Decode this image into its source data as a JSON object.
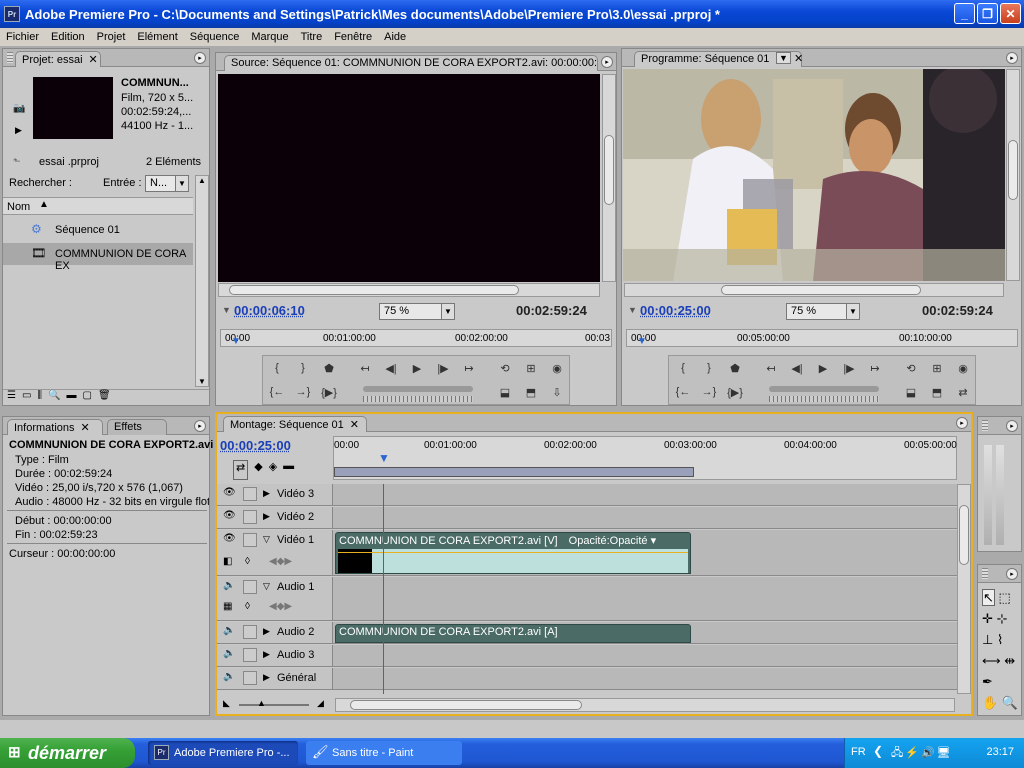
{
  "window": {
    "title": "Adobe Premiere Pro - C:\\Documents and Settings\\Patrick\\Mes documents\\Adobe\\Premiere Pro\\3.0\\essai .prproj *",
    "app_icon": "Pr"
  },
  "menu": [
    "Fichier",
    "Edition",
    "Projet",
    "Elément",
    "Séquence",
    "Marque",
    "Titre",
    "Fenêtre",
    "Aide"
  ],
  "project": {
    "tab": "Projet: essai",
    "clip_name": "COMMNUN...",
    "clip_line1": "Film, 720 x 5...",
    "clip_line2": "00:02:59:24,...",
    "clip_line3": "44100 Hz - 1...",
    "file": "essai .prproj",
    "count": "2 Eléments",
    "search_label": "Rechercher :",
    "entry_label": "Entrée :",
    "entry_value": "N...",
    "col_name": "Nom",
    "items": [
      {
        "label": "Séquence 01"
      },
      {
        "label": "COMMNUNION DE CORA EX"
      }
    ]
  },
  "source": {
    "tab": "Source: Séquence 01: COMMNUNION DE CORA EXPORT2.avi: 00:00:00:0",
    "timecode": "00:00:06:10",
    "zoom": "75 %",
    "duration": "00:02:59:24",
    "ruler": [
      "00:00",
      "00:01:00:00",
      "00:02:00:00",
      "00:03"
    ]
  },
  "program": {
    "tab": "Programme: Séquence 01",
    "timecode": "00:00:25:00",
    "zoom": "75 %",
    "duration": "00:02:59:24",
    "ruler": [
      "00:00",
      "00:05:00:00",
      "00:10:00:00"
    ]
  },
  "info": {
    "tab_info": "Informations",
    "tab_effects": "Effets",
    "name": "COMMNUNION DE CORA EXPORT2.avi",
    "type": "Type : Film",
    "duration": "Durée : 00:02:59:24",
    "video": "Vidéo : 25,00 i/s,720 x 576 (1,067)",
    "audio": "Audio : 48000 Hz - 32 bits en virgule flot",
    "start": "Début : 00:00:00:00",
    "end": "Fin : 00:02:59:23",
    "cursor": "Curseur : 00:00:00:00"
  },
  "timeline": {
    "tab": "Montage: Séquence 01",
    "timecode": "00:00:25:00",
    "ruler": [
      "00:00",
      "00:01:00:00",
      "00:02:00:00",
      "00:03:00:00",
      "00:04:00:00",
      "00:05:00:00"
    ],
    "tracks": [
      "Vidéo 3",
      "Vidéo 2",
      "Vidéo 1",
      "Audio 1",
      "Audio 2",
      "Audio 3",
      "Général"
    ],
    "video_clip": "COMMNUNION DE CORA EXPORT2.avi [V]",
    "opacity": "Opacité:Opacité",
    "audio_clip": "COMMNUNION DE CORA EXPORT2.avi [A]"
  },
  "taskbar": {
    "start": "démarrer",
    "items": [
      "Adobe Premiere Pro -...",
      "Sans titre - Paint"
    ],
    "lang": "FR",
    "clock": "23:17"
  },
  "colors": {
    "accent": "#1a3fb8",
    "clip": "#4a6b66",
    "playhead": "#e0301e",
    "active_border": "#e8b020"
  }
}
